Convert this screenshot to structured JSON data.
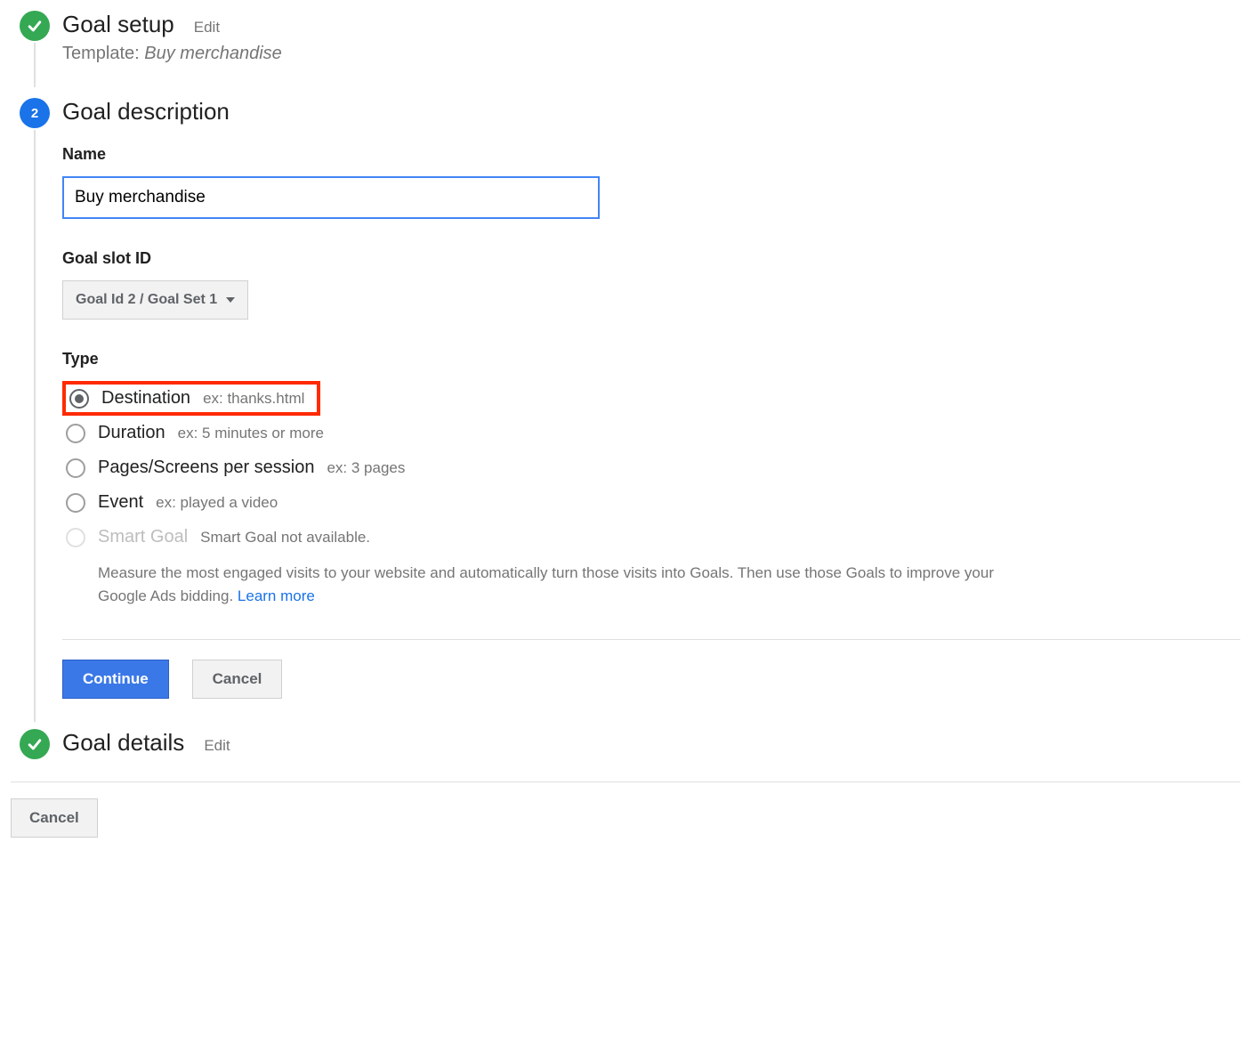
{
  "steps": {
    "setup": {
      "title": "Goal setup",
      "edit": "Edit",
      "template_label": "Template:",
      "template_value": "Buy merchandise"
    },
    "description": {
      "number": "2",
      "title": "Goal description",
      "name_label": "Name",
      "name_value": "Buy merchandise",
      "slot_label": "Goal slot ID",
      "slot_value": "Goal Id 2 / Goal Set 1",
      "type_label": "Type",
      "types": [
        {
          "label": "Destination",
          "hint": "ex: thanks.html",
          "checked": true,
          "disabled": false,
          "highlight": true
        },
        {
          "label": "Duration",
          "hint": "ex: 5 minutes or more",
          "checked": false,
          "disabled": false,
          "highlight": false
        },
        {
          "label": "Pages/Screens per session",
          "hint": "ex: 3 pages",
          "checked": false,
          "disabled": false,
          "highlight": false
        },
        {
          "label": "Event",
          "hint": "ex: played a video",
          "checked": false,
          "disabled": false,
          "highlight": false
        },
        {
          "label": "Smart Goal",
          "hint": "Smart Goal not available.",
          "checked": false,
          "disabled": true,
          "highlight": false
        }
      ],
      "smart_desc": "Measure the most engaged visits to your website and automatically turn those visits into Goals. Then use those Goals to improve your Google Ads bidding.",
      "learn_more": "Learn more",
      "continue": "Continue",
      "cancel": "Cancel"
    },
    "details": {
      "title": "Goal details",
      "edit": "Edit"
    }
  },
  "footer": {
    "cancel": "Cancel"
  }
}
